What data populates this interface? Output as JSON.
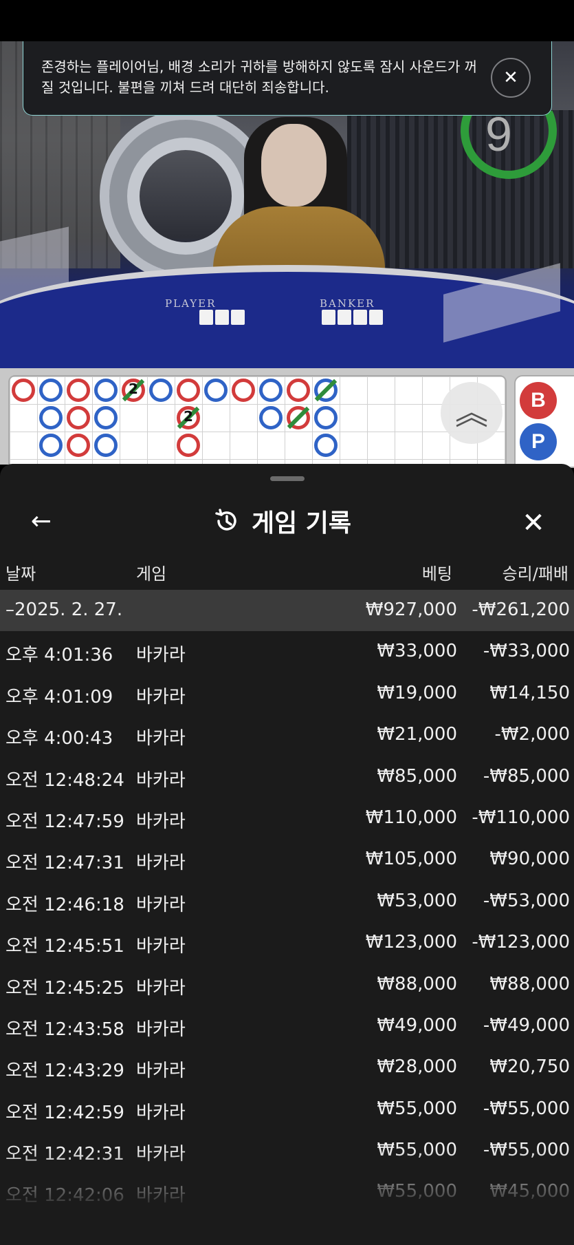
{
  "notice": {
    "text": "존경하는 플레이어님, 배경 소리가 귀하를 방해하지 않도록 잠시 사운드가 꺼질 것입니다. 불편을 끼쳐 드려 대단히 죄송합니다."
  },
  "video": {
    "timer": "9",
    "player_label": "PLAYER",
    "banker_label": "BANKER"
  },
  "roadmap": {
    "side_buttons": [
      "B",
      "P"
    ]
  },
  "history": {
    "title": "게임 기록",
    "columns": {
      "date": "날짜",
      "game": "게임",
      "bet": "베팅",
      "result": "승리/패배"
    },
    "summary": {
      "date": "–2025. 2. 27.",
      "bet": "₩927,000",
      "result": "-₩261,200"
    },
    "rows": [
      {
        "date": "오후 4:01:36",
        "game": "바카라",
        "bet": "₩33,000",
        "result": "-₩33,000"
      },
      {
        "date": "오후 4:01:09",
        "game": "바카라",
        "bet": "₩19,000",
        "result": "₩14,150"
      },
      {
        "date": "오후 4:00:43",
        "game": "바카라",
        "bet": "₩21,000",
        "result": "-₩2,000"
      },
      {
        "date": "오전 12:48:24",
        "game": "바카라",
        "bet": "₩85,000",
        "result": "-₩85,000"
      },
      {
        "date": "오전 12:47:59",
        "game": "바카라",
        "bet": "₩110,000",
        "result": "-₩110,000"
      },
      {
        "date": "오전 12:47:31",
        "game": "바카라",
        "bet": "₩105,000",
        "result": "₩90,000"
      },
      {
        "date": "오전 12:46:18",
        "game": "바카라",
        "bet": "₩53,000",
        "result": "-₩53,000"
      },
      {
        "date": "오전 12:45:51",
        "game": "바카라",
        "bet": "₩123,000",
        "result": "-₩123,000"
      },
      {
        "date": "오전 12:45:25",
        "game": "바카라",
        "bet": "₩88,000",
        "result": "₩88,000"
      },
      {
        "date": "오전 12:43:58",
        "game": "바카라",
        "bet": "₩49,000",
        "result": "-₩49,000"
      },
      {
        "date": "오전 12:43:29",
        "game": "바카라",
        "bet": "₩28,000",
        "result": "₩20,750"
      },
      {
        "date": "오전 12:42:59",
        "game": "바카라",
        "bet": "₩55,000",
        "result": "-₩55,000"
      },
      {
        "date": "오전 12:42:31",
        "game": "바카라",
        "bet": "₩55,000",
        "result": "-₩55,000"
      },
      {
        "date": "오전 12:42:06",
        "game": "바카라",
        "bet": "₩55,000",
        "result": "₩45,000"
      }
    ]
  },
  "colors": {
    "banker_red": "#d23b3b",
    "player_blue": "#2f63c6",
    "tie_green": "#2f8c3b",
    "sheet_bg": "#1b1b1b",
    "summary_bg": "#3b3b3b"
  }
}
